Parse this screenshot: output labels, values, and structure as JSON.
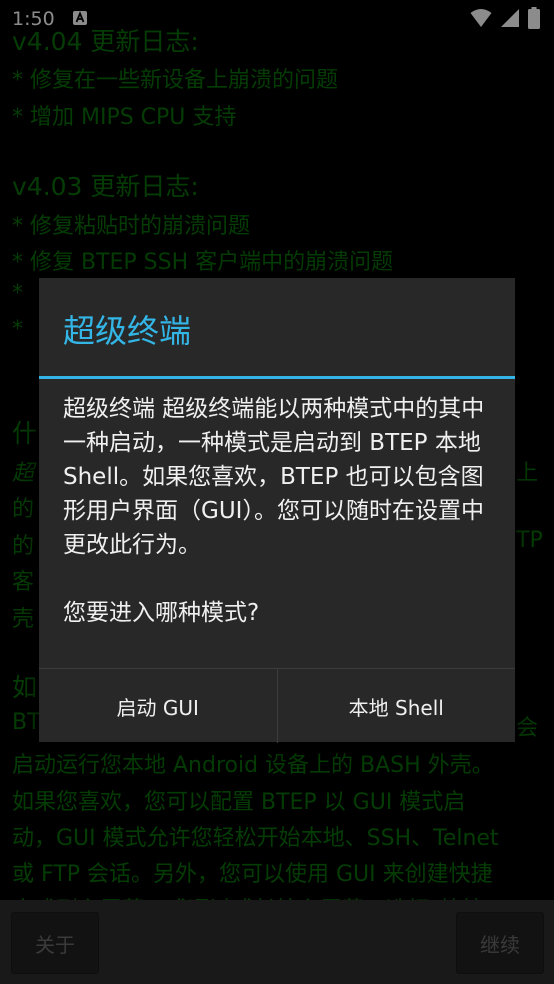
{
  "status_bar": {
    "time": "1:50"
  },
  "background": {
    "lines": [
      "v4.04 更新日志:",
      "* 修复在一些新设备上崩溃的问题",
      "* 增加 MIPS CPU 支持",
      "v4.03 更新日志:",
      "* 修复粘贴时的崩溃问题",
      "* 修复 BTEP SSH 客户端中的崩溃问题",
      "*",
      "*",
      "什",
      "超",
      "的",
      "的",
      "客",
      "壳",
      "如",
      "BT",
      "启动运行您本地 Android 设备上的 BASH 外壳。",
      "如果您喜欢，您可以配置 BTEP 以 GUI 模式启",
      "动，GUI 模式允许您轻松开始本地、SSH、Telnet",
      "或 FTP 会话。另外，您可以使用 GUI 来创建快捷",
      "方式到主屏幕，或通过或长按主屏幕，选择\"快捷"
    ],
    "right_fragments": [
      "上",
      "TP",
      "会"
    ]
  },
  "dialog": {
    "title": "超级终端",
    "message": "超级终端 超级终端能以两种模式中的其中一种启动，一种模式是启动到 BTEP 本地 Shell。如果您喜欢，BTEP 也可以包含图形用户界面（GUI）。您可以随时在设置中更改此行为。",
    "question": "您要进入哪种模式?",
    "button_gui": "启动 GUI",
    "button_shell": "本地 Shell"
  },
  "bottom_bar": {
    "about": "关于",
    "continue": "继续"
  }
}
